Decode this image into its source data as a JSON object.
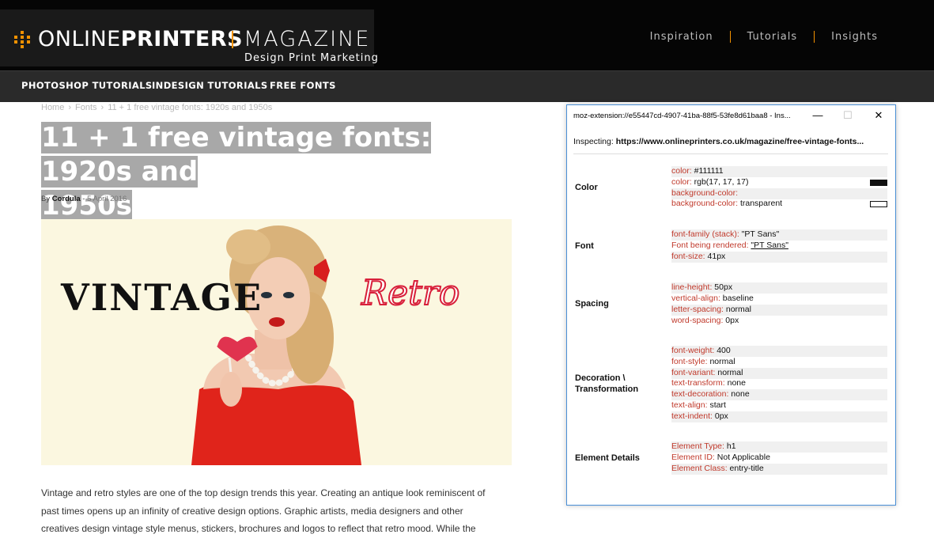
{
  "header": {
    "brand_light": "ONLINE",
    "brand_bold": "PRINTERS",
    "magazine": "MAGAZINE",
    "tagline": "Design Print Marketing",
    "nav": [
      "Inspiration",
      "Tutorials",
      "Insights"
    ],
    "accent_color": "#f39200"
  },
  "category_nav": [
    "PHOTOSHOP TUTORIALS",
    "INDESIGN TUTORIALS",
    "FREE FONTS"
  ],
  "article": {
    "breadcrumbs": [
      "Home",
      "Fonts",
      "11 + 1 free vintage fonts: 1920s and 1950s"
    ],
    "title_line1": "11 + 1 free vintage fonts: 1920s and",
    "title_line2": "1950s",
    "by": "By",
    "author": "Cordula",
    "date": "5 April 2016",
    "hero": {
      "left_text": "VINTAGE",
      "right_text": "Retro"
    },
    "body_lines": [
      "Vintage and retro styles are one of the top design trends this year. Creating an antique look reminiscent of",
      "past times opens up an infinity of creative design options. Graphic artists, media designers and other",
      "creatives design vintage style menus, stickers, brochures and logos to reflect that retro mood. While the"
    ]
  },
  "inspector": {
    "window_title": "moz-extension://e55447cd-4907-41ba-88f5-53fe8d61baa8 - Ins...",
    "controls": {
      "minimize": "—",
      "maximize": "☐",
      "close": "✕"
    },
    "inspecting_label": "Inspecting:",
    "inspecting_url": "https://www.onlineprinters.co.uk/magazine/free-vintage-fonts...",
    "sections": {
      "color": {
        "label": "Color",
        "props": [
          {
            "k": "color:",
            "v": "#111111"
          },
          {
            "k": "color:",
            "v": "rgb(17, 17, 17)"
          },
          {
            "k": "background-color:",
            "v": ""
          },
          {
            "k": "background-color:",
            "v": "transparent"
          }
        ]
      },
      "font": {
        "label": "Font",
        "props": [
          {
            "k": "font-family (stack):",
            "v": "\"PT Sans\""
          },
          {
            "k": "Font being rendered:",
            "v": "\"PT Sans\""
          },
          {
            "k": "font-size:",
            "v": "41px"
          }
        ]
      },
      "spacing": {
        "label": "Spacing",
        "props": [
          {
            "k": "line-height:",
            "v": "50px"
          },
          {
            "k": "vertical-align:",
            "v": "baseline"
          },
          {
            "k": "letter-spacing:",
            "v": "normal"
          },
          {
            "k": "word-spacing:",
            "v": "0px"
          }
        ]
      },
      "decoration": {
        "label_line1": "Decoration \\",
        "label_line2": "Transformation",
        "props": [
          {
            "k": "font-weight:",
            "v": "400"
          },
          {
            "k": "font-style:",
            "v": "normal"
          },
          {
            "k": "font-variant:",
            "v": "normal"
          },
          {
            "k": "text-transform:",
            "v": "none"
          },
          {
            "k": "text-decoration:",
            "v": "none"
          },
          {
            "k": "text-align:",
            "v": "start"
          },
          {
            "k": "text-indent:",
            "v": "0px"
          }
        ]
      },
      "element": {
        "label": "Element Details",
        "props": [
          {
            "k": "Element Type:",
            "v": "h1"
          },
          {
            "k": "Element ID:",
            "v": "Not Applicable"
          },
          {
            "k": "Element Class:",
            "v": "entry-title"
          }
        ]
      }
    }
  }
}
